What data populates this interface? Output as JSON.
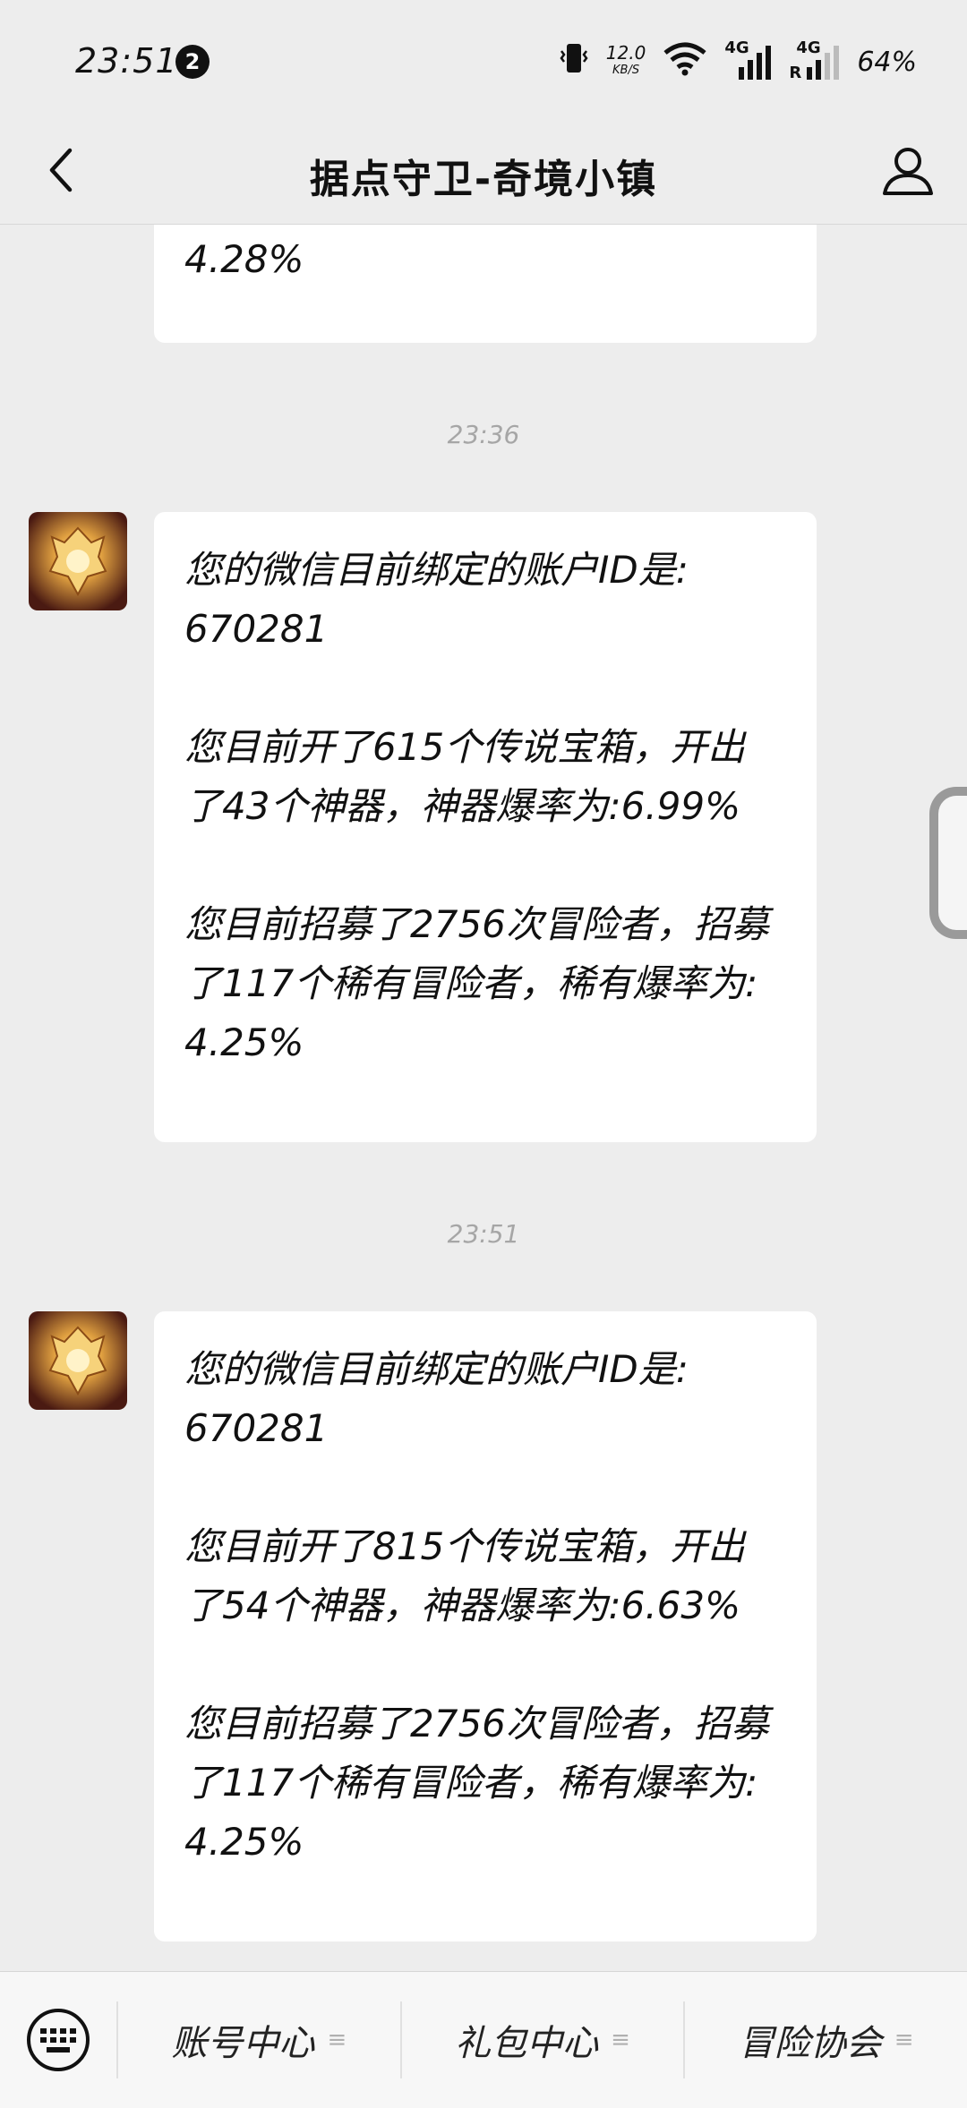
{
  "status_bar": {
    "time": "23:51",
    "notification_count": "2",
    "net_speed_value": "12.0",
    "net_speed_unit": "KB/S",
    "signal_1_label": "4G",
    "signal_2_label": "4G",
    "roaming_label": "R",
    "battery": "64%"
  },
  "header": {
    "title": "据点守卫-奇境小镇"
  },
  "messages": [
    {
      "truncated_tail": "4.28%"
    },
    {
      "timestamp": "23:36",
      "line1": "您的微信目前绑定的账户ID是:",
      "line2": "670281",
      "line3": "您目前开了615个传说宝箱，开出",
      "line4": "了43个神器，神器爆率为:6.99%",
      "line5": "您目前招募了2756次冒险者，招募",
      "line6": "了117个稀有冒险者，稀有爆率为:",
      "line7": "4.25%"
    },
    {
      "timestamp": "23:51",
      "line1": "您的微信目前绑定的账户ID是:",
      "line2": "670281",
      "line3": "您目前开了815个传说宝箱，开出",
      "line4": "了54个神器，神器爆率为:6.63%",
      "line5": "您目前招募了2756次冒险者，招募",
      "line6": "了117个稀有冒险者，稀有爆率为:",
      "line7": "4.25%"
    }
  ],
  "bottom_menu": {
    "items": [
      {
        "label": "账号中心"
      },
      {
        "label": "礼包中心"
      },
      {
        "label": "冒险协会"
      }
    ]
  },
  "icons": {
    "back": "chevron-left-icon",
    "profile": "person-icon",
    "keyboard": "keyboard-icon",
    "menu": "menu-lines-icon"
  }
}
